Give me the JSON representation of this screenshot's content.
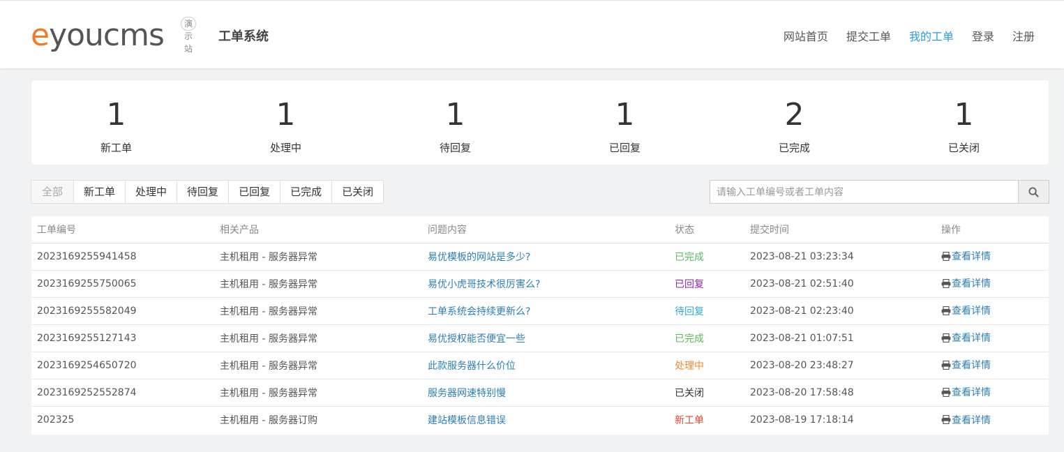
{
  "header": {
    "logo_e": "e",
    "logo_rest": "youcms",
    "logo_accent": "#f07c2b",
    "demo_badge": "演示站",
    "system_title": "工单系统",
    "nav": [
      {
        "label": "网站首页",
        "active": false
      },
      {
        "label": "提交工单",
        "active": false
      },
      {
        "label": "我的工单",
        "active": true
      },
      {
        "label": "登录",
        "active": false
      },
      {
        "label": "注册",
        "active": false
      }
    ]
  },
  "stats": [
    {
      "count": "1",
      "label": "新工单"
    },
    {
      "count": "1",
      "label": "处理中"
    },
    {
      "count": "1",
      "label": "待回复"
    },
    {
      "count": "1",
      "label": "已回复"
    },
    {
      "count": "2",
      "label": "已完成"
    },
    {
      "count": "1",
      "label": "已关闭"
    }
  ],
  "filters": [
    "全部",
    "新工单",
    "处理中",
    "待回复",
    "已回复",
    "已完成",
    "已关闭"
  ],
  "search": {
    "placeholder": "请输入工单编号或者工单内容",
    "icon": "search-icon"
  },
  "table": {
    "headers": [
      "工单编号",
      "相关产品",
      "问题内容",
      "状态",
      "提交时间",
      "操作"
    ],
    "rows": [
      {
        "id": "2023169255941458",
        "product": "主机租用 - 服务器异常",
        "question": "易优模板的网站是多少?",
        "status": "已完成",
        "status_color": "#5cb85c",
        "time": "2023-08-21 03:23:34",
        "action": "查看详情"
      },
      {
        "id": "2023169255750065",
        "product": "主机租用 - 服务器异常",
        "question": "易优小虎哥技术很厉害么?",
        "status": "已回复",
        "status_color": "#8e24aa",
        "time": "2023-08-21 02:51:40",
        "action": "查看详情"
      },
      {
        "id": "2023169255582049",
        "product": "主机租用 - 服务器异常",
        "question": "工单系统会持续更新么?",
        "status": "待回复",
        "status_color": "#31a9d6",
        "time": "2023-08-21 02:23:40",
        "action": "查看详情"
      },
      {
        "id": "2023169255127143",
        "product": "主机租用 - 服务器异常",
        "question": "易优授权能否便宜一些",
        "status": "已完成",
        "status_color": "#5cb85c",
        "time": "2023-08-21 01:07:51",
        "action": "查看详情"
      },
      {
        "id": "2023169254650720",
        "product": "主机租用 - 服务器异常",
        "question": "此款服务器什么价位",
        "status": "处理中",
        "status_color": "#f0892e",
        "time": "2023-08-20 23:48:27",
        "action": "查看详情"
      },
      {
        "id": "2023169252552874",
        "product": "主机租用 - 服务器异常",
        "question": "服务器网速特别慢",
        "status": "已关闭",
        "status_color": "#333333",
        "time": "2023-08-20 17:58:48",
        "action": "查看详情"
      },
      {
        "id": "202325",
        "product": "主机租用 - 服务器订购",
        "question": "建站模板信息错误",
        "status": "新工单",
        "status_color": "#e2452f",
        "time": "2023-08-19 17:18:14",
        "action": "查看详情"
      }
    ]
  }
}
